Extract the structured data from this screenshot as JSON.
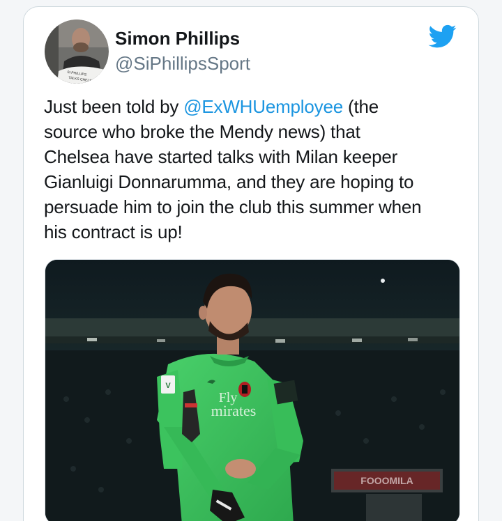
{
  "tweet": {
    "display_name": "Simon Phillips",
    "handle": "@SiPhillipsSport",
    "text_lines": [
      {
        "before": "Just been told by ",
        "mention": "@ExWHUemployee",
        "after": " (the"
      },
      {
        "text": "source who broke the Mendy news) that"
      },
      {
        "text": "Chelsea have started talks with Milan keeper"
      },
      {
        "text": "Gianluigi Donnarumma, and they are hoping to"
      },
      {
        "text": "persuade him to join the club this summer when"
      },
      {
        "text": "his contract is up!"
      }
    ]
  },
  "avatar": {
    "caption_top": "SI PHILLIPS",
    "caption_bottom": "TALKS CHELSEA"
  },
  "photo": {
    "shirt_sponsor_line1": "Fly",
    "shirt_sponsor_line2": "mirates",
    "ad_board": "FOOOMILA"
  },
  "colors": {
    "brand": "#1da1f2",
    "mention": "#1b95e0",
    "text": "#14171a",
    "secondary": "#657786",
    "keeper_kit": "#3cc35e"
  },
  "icons": {
    "logo": "twitter-bird-icon"
  }
}
